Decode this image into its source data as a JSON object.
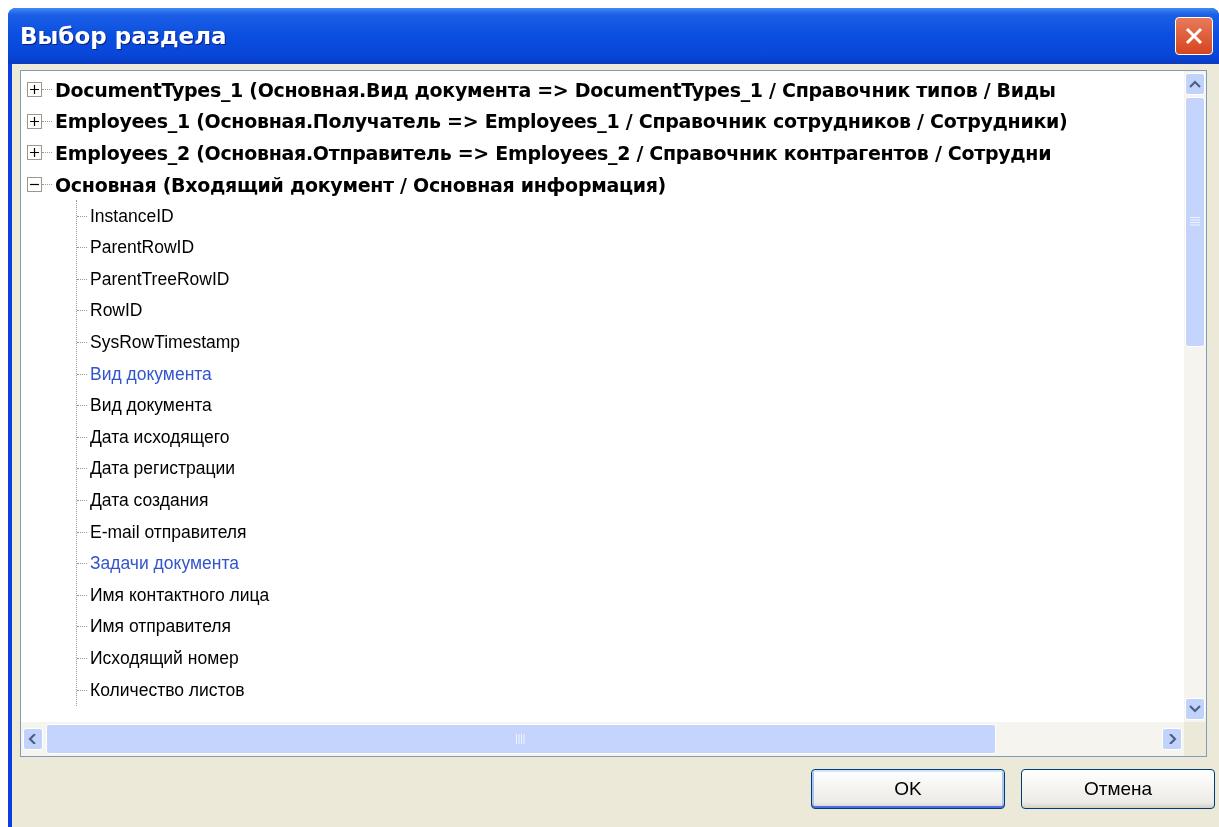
{
  "window": {
    "title": "Выбор раздела"
  },
  "tree": {
    "items": [
      {
        "label": "DocumentTypes_1 (Основная.Вид документа => DocumentTypes_1 / Справочник типов / Виды",
        "expanded": false
      },
      {
        "label": "Employees_1 (Основная.Получатель => Employees_1 / Справочник сотрудников / Сотрудники)",
        "expanded": false
      },
      {
        "label": "Employees_2 (Основная.Отправитель => Employees_2 / Справочник контрагентов / Сотрудни",
        "expanded": false
      },
      {
        "label": "Основная (Входящий документ / Основная информация)",
        "expanded": true,
        "children": [
          {
            "label": "InstanceID",
            "kind": "field"
          },
          {
            "label": "ParentRowID",
            "kind": "field"
          },
          {
            "label": "ParentTreeRowID",
            "kind": "field"
          },
          {
            "label": "RowID",
            "kind": "field"
          },
          {
            "label": "SysRowTimestamp",
            "kind": "field"
          },
          {
            "label": "Вид документа",
            "kind": "link"
          },
          {
            "label": "Вид документа",
            "kind": "field"
          },
          {
            "label": "Дата исходящего",
            "kind": "field"
          },
          {
            "label": "Дата регистрации",
            "kind": "field"
          },
          {
            "label": "Дата создания",
            "kind": "field"
          },
          {
            "label": "E-mail отправителя",
            "kind": "field"
          },
          {
            "label": "Задачи документа",
            "kind": "link"
          },
          {
            "label": "Имя контактного лица",
            "kind": "field"
          },
          {
            "label": "Имя отправителя",
            "kind": "field"
          },
          {
            "label": "Исходящий номер",
            "kind": "field"
          },
          {
            "label": "Количество листов",
            "kind": "field"
          }
        ]
      }
    ]
  },
  "buttons": [
    {
      "label": "OK",
      "default": true
    },
    {
      "label": "Отмена",
      "default": false
    }
  ]
}
